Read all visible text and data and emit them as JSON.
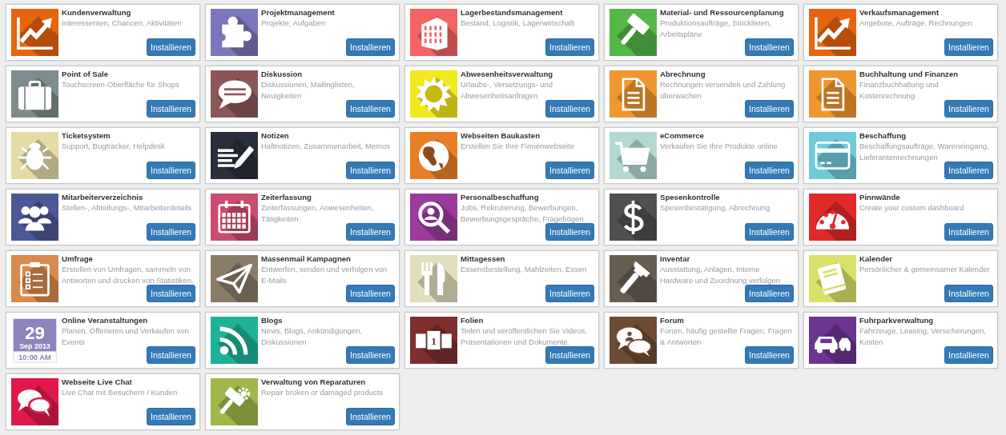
{
  "apps": [
    {
      "kind": "tile",
      "title": "Kundenverwaltung",
      "description": "Interessenten, Chancen, Aktivitäten",
      "button": "Installieren",
      "color": "#e8650f"
    },
    {
      "kind": "tile",
      "title": "Projektmanagement",
      "description": "Projekte, Aufgaben",
      "button": "Installieren",
      "color": "#7c77bb"
    },
    {
      "kind": "tile",
      "title": "Lagerbestandsmanagement",
      "description": "Bestand, Logistik, Lagerwirtschaft",
      "button": "Installieren",
      "color": "#f26466"
    },
    {
      "kind": "tile",
      "title": "Material- und Ressourcenplanung",
      "description": "Produktionsaufträge, Stücklisten, Arbeitspläne",
      "button": "Installieren",
      "color": "#55b748"
    },
    {
      "kind": "tile",
      "title": "Verkaufsmanagement",
      "description": "Angebote, Aufträge, Rechnungen",
      "button": "Installieren",
      "color": "#e8650f"
    },
    {
      "kind": "tile",
      "title": "Point of Sale",
      "description": "Touchscreen-Oberfläche für Shops",
      "button": "Installieren",
      "color": "#7f8c8d"
    },
    {
      "kind": "tile",
      "title": "Diskussion",
      "description": "Diskussionen, Mailinglisten, Neuigkeiten",
      "button": "Installieren",
      "color": "#8d5656"
    },
    {
      "kind": "tile",
      "title": "Abwesenheitsverwaltung",
      "description": "Urlaubs-, Versetzungs- und Abwesenheitsanfragen",
      "button": "Installieren",
      "color": "#f2e81c"
    },
    {
      "kind": "tile",
      "title": "Abrechnung",
      "description": "Rechnungen versenden und Zahlung überwachen",
      "button": "Installieren",
      "color": "#f0962e"
    },
    {
      "kind": "tile",
      "title": "Buchhaltung und Finanzen",
      "description": "Finanzbuchhaltung und Kostenrechnung",
      "button": "Installieren",
      "color": "#f0962e"
    },
    {
      "kind": "tile",
      "title": "Ticketsystem",
      "description": "Support, Bugtracker, Helpdesk",
      "button": "Installieren",
      "color": "#e4dba6"
    },
    {
      "kind": "tile",
      "title": "Notizen",
      "description": "Haftnotizen, Zusammenarbeit, Memos",
      "button": "Installieren",
      "color": "#2a2f3d"
    },
    {
      "kind": "tile",
      "title": "Webseiten Baukasten",
      "description": "Erstellen Sie Ihre Firmenwebseite",
      "button": "Installieren",
      "color": "#e87f26"
    },
    {
      "kind": "tile",
      "title": "eCommerce",
      "description": "Verkaufen Sie Ihre Produkte online",
      "button": "Installieren",
      "color": "#b1d9d0"
    },
    {
      "kind": "tile",
      "title": "Beschaffung",
      "description": "Beschaffungsaufträge, Wareneingang, Lieferantenrechnungen",
      "button": "Installieren",
      "color": "#6fcbd9"
    },
    {
      "kind": "tile",
      "title": "Mitarbeiterverzeichnis",
      "description": "Stellen-, Abteilungs-, Mitarbeiterdetails",
      "button": "Installieren",
      "color": "#4d5896"
    },
    {
      "kind": "tile",
      "title": "Zeiterfassung",
      "description": "Zeiterfassungen, Anwesenheiten, Tätigkeiten",
      "button": "Installieren",
      "color": "#cc4c6e"
    },
    {
      "kind": "tile",
      "title": "Personalbeschaffung",
      "description": "Jobs, Rekrutierung, Bewerbungen, Bewerbungsgespräche, Fragebögen",
      "button": "Installieren",
      "color": "#9b3b9e"
    },
    {
      "kind": "tile",
      "title": "Spesenkontrolle",
      "description": "Spesenbestätigung, Abrechnung",
      "button": "Installieren",
      "color": "#505050"
    },
    {
      "kind": "tile",
      "title": "Pinnwände",
      "description": "Create your custom dashboard",
      "button": "Installieren",
      "color": "#e32a2a"
    },
    {
      "kind": "tile",
      "title": "Umfrage",
      "description": "Erstellen von Umfragen, sammeln von Antworten und drucken von Statistiken.",
      "button": "Installieren",
      "color": "#d88a4d"
    },
    {
      "kind": "tile",
      "title": "Massenmail Kampagnen",
      "description": "Entwerfen, senden und verfolgen von E-Mails",
      "button": "Installieren",
      "color": "#8b7c68"
    },
    {
      "kind": "tile",
      "title": "Mittagessen",
      "description": "Essensbestellung, Mahlzeiten, Essen",
      "button": "Installieren",
      "color": "#e1dfbd"
    },
    {
      "kind": "tile",
      "title": "Inventar",
      "description": "Ausstattung, Anlagen, Interne Hardware und Zuordnung verfolgen",
      "button": "Installieren",
      "color": "#675e52"
    },
    {
      "kind": "tile",
      "title": "Kalender",
      "description": "Persönlicher & gemeinsamer Kalender",
      "button": "Installieren",
      "color": "#d9e06a"
    },
    {
      "kind": "calendar",
      "title": "Online Veranstaltungen",
      "description": "Planen, Offerieren und Verkaufen von Events",
      "button": "Installieren",
      "color": "#8c85bb",
      "day": "29",
      "month": "Sep 2013",
      "time": "10:00 AM"
    },
    {
      "kind": "tile",
      "title": "Blogs",
      "description": "News, Blogs, Ankündigungen, Diskussionen",
      "button": "Installieren",
      "color": "#1eb296"
    },
    {
      "kind": "tile",
      "title": "Folien",
      "description": "Teilen und veröffentlichen Sie Videos, Präsentationen und Dokumente.",
      "button": "Installieren",
      "color": "#7d2e2e",
      "icon_text": "1"
    },
    {
      "kind": "tile",
      "title": "Forum",
      "description": "Forum, häufig gestellte Fragen, Fragen & Antworten",
      "button": "Installieren",
      "color": "#6e4b33"
    },
    {
      "kind": "tile",
      "title": "Fuhrparkverwaltung",
      "description": "Fahrzeuge, Leasing, Versicherungen, Kosten",
      "button": "Installieren",
      "color": "#6c3590"
    },
    {
      "kind": "tile",
      "title": "Webseite Live Chat",
      "description": "Live Chat mit Besuchern / Kunden",
      "button": "Installieren",
      "color": "#e0194b"
    },
    {
      "kind": "tile",
      "title": "Verwaltung von Reparaturen",
      "description": "Repair broken or damaged products",
      "button": "Installieren",
      "color": "#a0b84a"
    }
  ]
}
